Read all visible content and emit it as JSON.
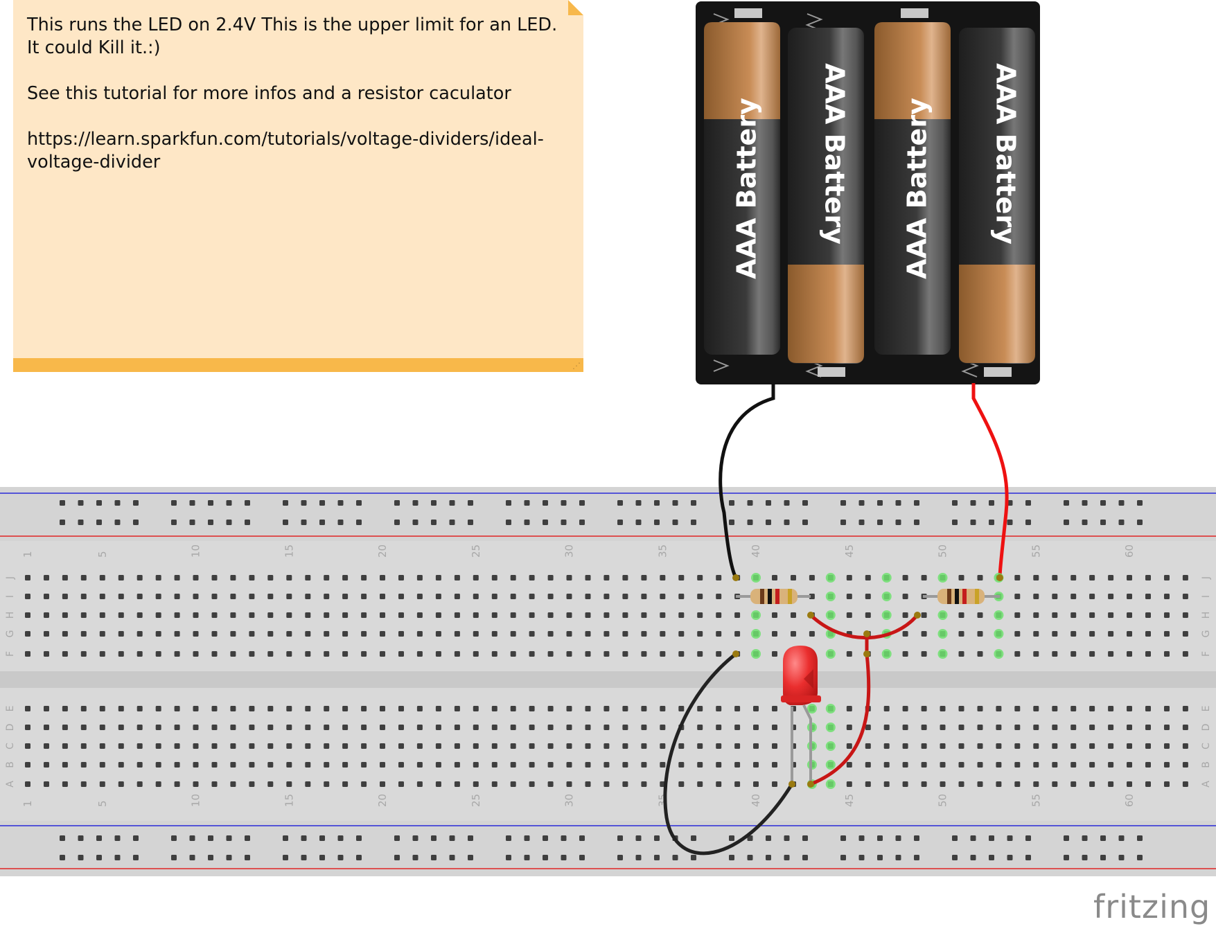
{
  "note": {
    "line1": "This runs the LED on 2.4V This is the upper limit for an LED. It could Kill it.:)",
    "line2": "See this tutorial for more infos and a resistor caculator",
    "line3": "https://learn.sparkfun.com/tutorials/voltage-dividers/ideal-voltage-divider"
  },
  "battery_pack": {
    "cells": [
      {
        "label": "AAA Battery"
      },
      {
        "label": "AAA Battery"
      },
      {
        "label": "AAA Battery"
      },
      {
        "label": "AAA Battery"
      }
    ]
  },
  "breadboard": {
    "columns": 63,
    "column_numbers": [
      "1",
      "5",
      "10",
      "15",
      "20",
      "25",
      "30",
      "35",
      "40",
      "45",
      "50",
      "55",
      "60"
    ],
    "rows_top": [
      "J",
      "I",
      "H",
      "G",
      "F"
    ],
    "rows_bottom": [
      "E",
      "D",
      "C",
      "B",
      "A"
    ]
  },
  "logo": "fritzing",
  "colors": {
    "note_bg": "#fee7c6",
    "note_bar": "#f8b84a",
    "breadboard": "#d9d9d9",
    "wire_black": "#111111",
    "wire_red": "#ee1111",
    "led": "#e62b2b",
    "highlight": "#6ee06e"
  }
}
